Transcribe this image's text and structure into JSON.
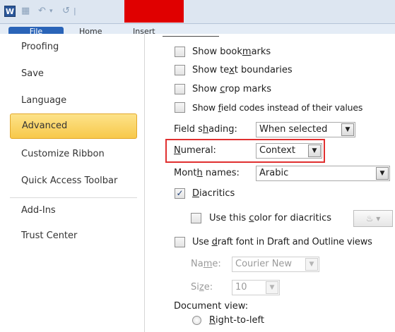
{
  "titlebar": {
    "app_icon": "W",
    "quick_access_icons": [
      "save-icon",
      "undo-icon",
      "redo-icon"
    ]
  },
  "ribbon": {
    "tabs": [
      {
        "label": "File"
      },
      {
        "label": "Home"
      },
      {
        "label": "Insert"
      }
    ]
  },
  "sidebar": {
    "items": [
      {
        "label": "Proofing"
      },
      {
        "label": "Save"
      },
      {
        "label": "Language"
      },
      {
        "label": "Advanced",
        "selected": true
      },
      {
        "label": "Customize Ribbon"
      },
      {
        "label": "Quick Access Toolbar"
      },
      {
        "label": "Add-Ins"
      },
      {
        "label": "Trust Center"
      }
    ]
  },
  "options": {
    "show_bookmarks": {
      "pre": "Show book",
      "key": "m",
      "post": "arks",
      "checked": false
    },
    "show_text_boundaries": {
      "pre": "Show te",
      "key": "x",
      "post": "t boundaries",
      "checked": false
    },
    "show_crop_marks": {
      "pre": "Show ",
      "key": "c",
      "post": "rop marks",
      "checked": false
    },
    "show_field_codes": {
      "pre": "Show ",
      "key": "f",
      "post": "ield codes instead of their values",
      "checked": false
    },
    "field_shading": {
      "pre": "Field s",
      "key": "h",
      "post": "ading:",
      "value": "When selected"
    },
    "numeral": {
      "pre": "",
      "key": "N",
      "post": "umeral:",
      "value": "Context"
    },
    "month_names": {
      "pre": "Mont",
      "key": "h",
      "post": " names:",
      "value": "Arabic"
    },
    "diacritics": {
      "pre": "",
      "key": "D",
      "post": "iacritics",
      "checked": true
    },
    "diacritics_color": {
      "pre": "Use this ",
      "key": "c",
      "post": "olor for diacritics",
      "checked": false
    },
    "draft_font": {
      "pre": "Use ",
      "key": "d",
      "post": "raft font in Draft and Outline views",
      "checked": false
    },
    "name": {
      "pre": "Na",
      "key": "m",
      "post": "e:",
      "value": "Courier New"
    },
    "size": {
      "pre": "Si",
      "key": "z",
      "post": "e:",
      "value": "10"
    },
    "document_view": {
      "label": "Document view:"
    },
    "right_to_left": {
      "pre": "",
      "key": "R",
      "post": "ight-to-left"
    }
  },
  "colors": {
    "selected_nav_bg": "#f7c84a",
    "highlight_border": "#e03030",
    "redaction": "#e00000"
  }
}
